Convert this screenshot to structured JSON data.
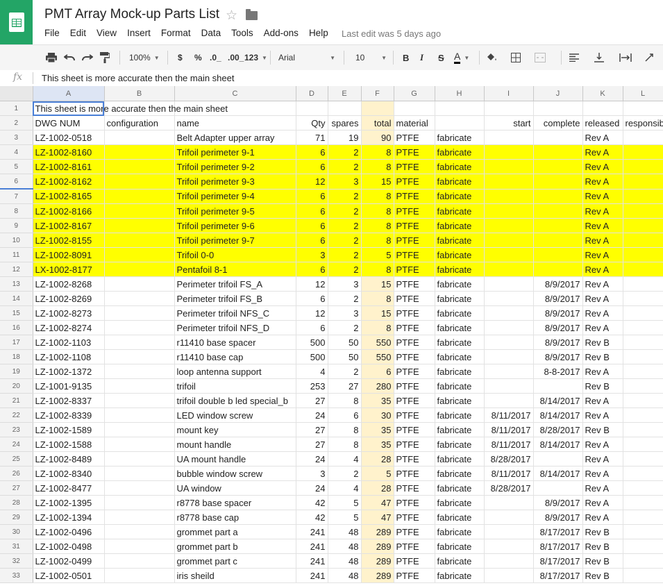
{
  "app": {
    "title": "PMT Array Mock-up Parts List",
    "menu": [
      "File",
      "Edit",
      "View",
      "Insert",
      "Format",
      "Data",
      "Tools",
      "Add-ons",
      "Help"
    ],
    "last_edit": "Last edit was 5 days ago"
  },
  "toolbar": {
    "zoom": "100%",
    "currency": "$",
    "percent": "%",
    "dec_less": ".0_",
    "dec_more": ".00_",
    "more_formats": "123",
    "font": "Arial",
    "font_size": "10",
    "bold": "B",
    "italic": "I",
    "strike": "S",
    "text_color": "A"
  },
  "formula_bar": {
    "fx": "fx",
    "value": "This sheet is more accurate then the main sheet"
  },
  "columns": [
    "A",
    "B",
    "C",
    "D",
    "E",
    "F",
    "G",
    "H",
    "I",
    "J",
    "K",
    "L"
  ],
  "highlight_color": "#ffff00",
  "total_column_color": "#fff2cc",
  "rows": [
    {
      "n": "1",
      "cells": [
        "This sheet is more accurate then the main sheet",
        "",
        "",
        "",
        "",
        "",
        "",
        "",
        "",
        "",
        "",
        ""
      ]
    },
    {
      "n": "2",
      "cells": [
        "DWG NUM",
        "configuration",
        "name",
        "Qty",
        "spares",
        "total",
        "material",
        "",
        "start",
        "complete",
        "released",
        "responsible"
      ]
    },
    {
      "n": "3",
      "cells": [
        "LZ-1002-0518",
        "",
        "Belt Adapter upper array",
        "71",
        "19",
        "90",
        "PTFE",
        "fabricate",
        "",
        "",
        "Rev A",
        ""
      ]
    },
    {
      "n": "4",
      "hl": true,
      "cells": [
        "LZ-1002-8160",
        "",
        "Trifoil perimeter 9-1",
        "6",
        "2",
        "8",
        "PTFE",
        "fabricate",
        "",
        "",
        "Rev A",
        ""
      ]
    },
    {
      "n": "5",
      "hl": true,
      "cells": [
        "LZ-1002-8161",
        "",
        "Trifoil perimeter 9-2",
        "6",
        "2",
        "8",
        "PTFE",
        "fabricate",
        "",
        "",
        "Rev A",
        ""
      ]
    },
    {
      "n": "6",
      "hl": true,
      "cells": [
        "LZ-1002-8162",
        "",
        "Trifoil perimeter 9-3",
        "12",
        "3",
        "15",
        "PTFE",
        "fabricate",
        "",
        "",
        "Rev A",
        ""
      ]
    },
    {
      "n": "7",
      "hl": true,
      "cells": [
        "LZ-1002-8165",
        "",
        "Trifoil perimeter 9-4",
        "6",
        "2",
        "8",
        "PTFE",
        "fabricate",
        "",
        "",
        "Rev A",
        ""
      ]
    },
    {
      "n": "8",
      "hl": true,
      "cells": [
        "LZ-1002-8166",
        "",
        "Trifoil perimeter 9-5",
        "6",
        "2",
        "8",
        "PTFE",
        "fabricate",
        "",
        "",
        "Rev A",
        ""
      ]
    },
    {
      "n": "9",
      "hl": true,
      "cells": [
        "LZ-1002-8167",
        "",
        "Trifoil perimeter 9-6",
        "6",
        "2",
        "8",
        "PTFE",
        "fabricate",
        "",
        "",
        "Rev A",
        ""
      ]
    },
    {
      "n": "10",
      "hl": true,
      "cells": [
        "LZ-1002-8155",
        "",
        "Trifoil perimeter 9-7",
        "6",
        "2",
        "8",
        "PTFE",
        "fabricate",
        "",
        "",
        "Rev A",
        ""
      ]
    },
    {
      "n": "11",
      "hl": true,
      "cells": [
        "LZ-1002-8091",
        "",
        "Trifoil 0-0",
        "3",
        "2",
        "5",
        "PTFE",
        "fabricate",
        "",
        "",
        "Rev A",
        ""
      ]
    },
    {
      "n": "12",
      "hl": true,
      "cells": [
        "LX-1002-8177",
        "",
        "Pentafoil 8-1",
        "6",
        "2",
        "8",
        "PTFE",
        "fabricate",
        "",
        "",
        "Rev A",
        ""
      ]
    },
    {
      "n": "13",
      "cells": [
        "LZ-1002-8268",
        "",
        "Perimeter trifoil FS_A",
        "12",
        "3",
        "15",
        "PTFE",
        "fabricate",
        "",
        "8/9/2017",
        "Rev A",
        ""
      ]
    },
    {
      "n": "14",
      "cells": [
        "LZ-1002-8269",
        "",
        "Perimeter trifoil FS_B",
        "6",
        "2",
        "8",
        "PTFE",
        "fabricate",
        "",
        "8/9/2017",
        "Rev A",
        ""
      ]
    },
    {
      "n": "15",
      "cells": [
        "LZ-1002-8273",
        "",
        "Perimeter trifoil NFS_C",
        "12",
        "3",
        "15",
        "PTFE",
        "fabricate",
        "",
        "8/9/2017",
        "Rev A",
        ""
      ]
    },
    {
      "n": "16",
      "cells": [
        "LZ-1002-8274",
        "",
        "Perimeter trifoil NFS_D",
        "6",
        "2",
        "8",
        "PTFE",
        "fabricate",
        "",
        "8/9/2017",
        "Rev A",
        ""
      ]
    },
    {
      "n": "17",
      "cells": [
        "LZ-1002-1103",
        "",
        "r11410 base spacer",
        "500",
        "50",
        "550",
        "PTFE",
        "fabricate",
        "",
        "8/9/2017",
        "Rev B",
        ""
      ]
    },
    {
      "n": "18",
      "cells": [
        "LZ-1002-1108",
        "",
        "r11410 base cap",
        "500",
        "50",
        "550",
        "PTFE",
        "fabricate",
        "",
        "8/9/2017",
        "Rev B",
        ""
      ]
    },
    {
      "n": "19",
      "cells": [
        "LZ-1002-1372",
        "",
        "loop antenna support",
        "4",
        "2",
        "6",
        "PTFE",
        "fabricate",
        "",
        "8-8-2017",
        "Rev A",
        ""
      ]
    },
    {
      "n": "20",
      "cells": [
        "LZ-1001-9135",
        "",
        "trifoil",
        "253",
        "27",
        "280",
        "PTFE",
        "fabricate",
        "",
        "",
        "Rev B",
        ""
      ]
    },
    {
      "n": "21",
      "cells": [
        "LZ-1002-8337",
        "",
        "trifoil double b led special_b",
        "27",
        "8",
        "35",
        "PTFE",
        "fabricate",
        "",
        "8/14/2017",
        "Rev A",
        ""
      ]
    },
    {
      "n": "22",
      "cells": [
        "LZ-1002-8339",
        "",
        "LED window screw",
        "24",
        "6",
        "30",
        "PTFE",
        "fabricate",
        "8/11/2017",
        "8/14/2017",
        "Rev A",
        ""
      ]
    },
    {
      "n": "23",
      "cells": [
        "LZ-1002-1589",
        "",
        "mount key",
        "27",
        "8",
        "35",
        "PTFE",
        "fabricate",
        "8/11/2017",
        "8/28/2017",
        "Rev B",
        ""
      ]
    },
    {
      "n": "24",
      "cells": [
        "LZ-1002-1588",
        "",
        "mount handle",
        "27",
        "8",
        "35",
        "PTFE",
        "fabricate",
        "8/11/2017",
        "8/14/2017",
        "Rev A",
        ""
      ]
    },
    {
      "n": "25",
      "cells": [
        "LZ-1002-8489",
        "",
        "UA mount handle",
        "24",
        "4",
        "28",
        "PTFE",
        "fabricate",
        "8/28/2017",
        "",
        "Rev A",
        ""
      ]
    },
    {
      "n": "26",
      "cells": [
        "LZ-1002-8340",
        "",
        "bubble window screw",
        "3",
        "2",
        "5",
        "PTFE",
        "fabricate",
        "8/11/2017",
        "8/14/2017",
        "Rev A",
        ""
      ]
    },
    {
      "n": "27",
      "cells": [
        "LZ-1002-8477",
        "",
        "UA window",
        "24",
        "4",
        "28",
        "PTFE",
        "fabricate",
        "8/28/2017",
        "",
        "Rev A",
        ""
      ]
    },
    {
      "n": "28",
      "cells": [
        "LZ-1002-1395",
        "",
        "r8778 base spacer",
        "42",
        "5",
        "47",
        "PTFE",
        "fabricate",
        "",
        "8/9/2017",
        "Rev A",
        ""
      ]
    },
    {
      "n": "29",
      "cells": [
        "LZ-1002-1394",
        "",
        "r8778 base cap",
        "42",
        "5",
        "47",
        "PTFE",
        "fabricate",
        "",
        "8/9/2017",
        "Rev A",
        ""
      ]
    },
    {
      "n": "30",
      "cells": [
        "LZ-1002-0496",
        "",
        "grommet part a",
        "241",
        "48",
        "289",
        "PTFE",
        "fabricate",
        "",
        "8/17/2017",
        "Rev B",
        ""
      ]
    },
    {
      "n": "31",
      "cells": [
        "LZ-1002-0498",
        "",
        "grommet part b",
        "241",
        "48",
        "289",
        "PTFE",
        "fabricate",
        "",
        "8/17/2017",
        "Rev B",
        ""
      ]
    },
    {
      "n": "32",
      "cells": [
        "LZ-1002-0499",
        "",
        "grommet part c",
        "241",
        "48",
        "289",
        "PTFE",
        "fabricate",
        "",
        "8/17/2017",
        "Rev B",
        ""
      ]
    },
    {
      "n": "33",
      "cells": [
        "LZ-1002-0501",
        "",
        "iris sheild",
        "241",
        "48",
        "289",
        "PTFE",
        "fabricate",
        "",
        "8/17/2017",
        "Rev B",
        ""
      ]
    }
  ]
}
